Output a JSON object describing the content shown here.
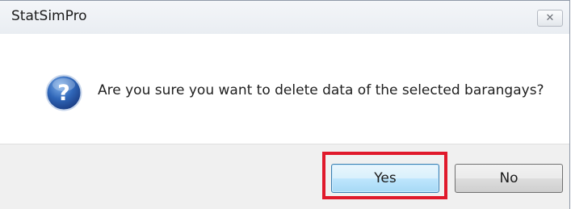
{
  "window": {
    "title": "StatSimPro",
    "close_glyph": "✕"
  },
  "dialog": {
    "icon": "question-icon",
    "message": "Are you sure you want to delete data of the selected barangays?"
  },
  "buttons": {
    "yes_label": "Yes",
    "no_label": "No"
  },
  "annotation": {
    "highlight_color": "#e0192b",
    "highlight_target": "Yes"
  },
  "colors": {
    "icon_blue": "#2a5fae",
    "default_button_border": "#3c7fb1"
  }
}
